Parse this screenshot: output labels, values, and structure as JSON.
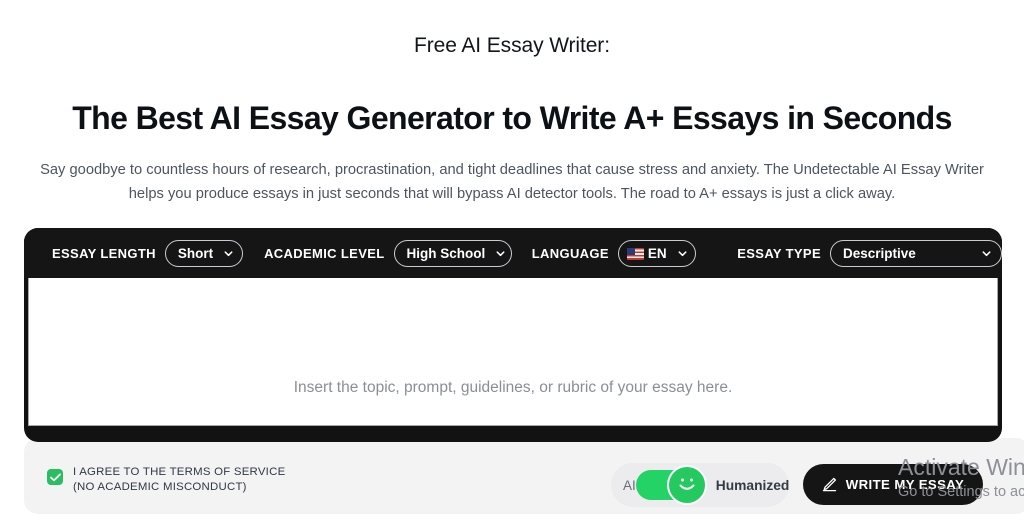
{
  "hero": {
    "eyebrow": "Free AI Essay Writer:",
    "headline": "The Best AI Essay Generator to Write A+ Essays in Seconds",
    "subcopy": "Say goodbye to countless hours of research, procrastination, and tight deadlines that cause stress and anxiety. The Undetectable AI Essay Writer helps you produce essays in just seconds that will bypass AI detector tools. The road to A+ essays is just a click away."
  },
  "toolbar": {
    "essay_length": {
      "label": "ESSAY LENGTH",
      "value": "Short"
    },
    "academic_level": {
      "label": "ACADEMIC LEVEL",
      "value": "High School"
    },
    "language": {
      "label": "LANGUAGE",
      "value": "EN",
      "flag": "us-flag-icon"
    },
    "essay_type": {
      "label": "ESSAY TYPE",
      "value": "Descriptive"
    }
  },
  "editor": {
    "placeholder": "Insert the topic, prompt, guidelines, or rubric of your essay here.",
    "value": ""
  },
  "footer": {
    "agree_line1": "I AGREE TO THE TERMS OF SERVICE",
    "agree_line2": "(NO ACADEMIC MISCONDUCT)",
    "checkbox_checked": "true",
    "toggle_left_label": "AI",
    "toggle_right_label": "Humanized",
    "toggle_state": "Humanized",
    "write_button_label": "WRITE MY ESSAY",
    "write_button_icon": "pencil-icon"
  },
  "watermark": {
    "title": "Activate Windows",
    "subtitle": "Go to Settings to activate Windows."
  },
  "colors": {
    "accent_green": "#24c95f",
    "dark": "#151515",
    "panel": "#f3f3f4",
    "muted_text": "#4c5560"
  }
}
